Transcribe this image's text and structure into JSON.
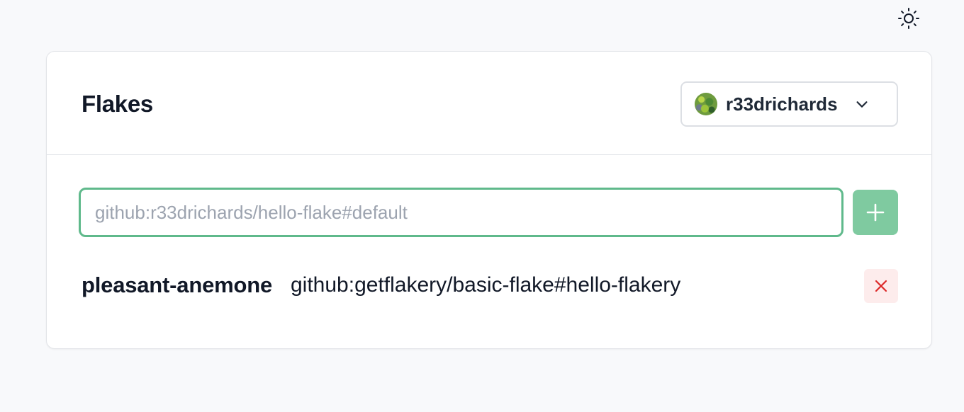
{
  "theme_toggle": {
    "icon": "sun-icon"
  },
  "card": {
    "title": "Flakes",
    "user_select": {
      "avatar": "avatar",
      "username": "r33drichards",
      "icon": "chevron-down-icon"
    },
    "add_flake": {
      "placeholder": "github:r33drichards/hello-flake#default",
      "value": "",
      "focus_color": "#5fb98b",
      "button_icon": "plus-icon",
      "button_color": "#7fcaa0"
    },
    "flakes": [
      {
        "name": "pleasant-anemone",
        "ref": "github:getflakery/basic-flake#hello-flakery",
        "delete_icon": "close-icon",
        "delete_color": "#dc2626"
      }
    ]
  }
}
